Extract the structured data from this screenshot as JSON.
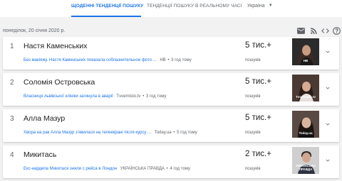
{
  "tabs": {
    "daily": "Щоденні тенденції пошуку",
    "realtime": "Тенденції пошуку в реальному часі"
  },
  "region": "Україна",
  "date": "понеділок, 20 січня 2020 р.",
  "icons": [
    "mail-icon",
    "rss-icon",
    "embed-code-icon",
    "help-icon",
    "chevron-down-icon"
  ],
  "accent_color": "#1a73e8",
  "trends": [
    {
      "rank": "1",
      "title": "Настя Каменських",
      "article": "Без макіяжу. Настя Каменських показала соблазнительное фото ...",
      "source": "НВ",
      "time": "3 год тому",
      "count": "5 тис.+",
      "count_label": "пошуків",
      "thumb_label": "НВ"
    },
    {
      "rank": "2",
      "title": "Соломія Островська",
      "article": "Власниця львівської клініки загинула в аварії",
      "source": "Tvoemisto.tv",
      "time": "3 год тому",
      "count": "5 тис.+",
      "count_label": "пошуків",
      "thumb_label": "Tvoemisto.tv"
    },
    {
      "rank": "3",
      "title": "Алла Мазур",
      "article": "Хвора на рак Алла Мазур з'явилася на телеекрані після курсу ...",
      "source": "Today.ua",
      "time": "5 год тому",
      "count": "5 тис.+",
      "count_label": "пошуків",
      "thumb_label": "Today.ua"
    },
    {
      "rank": "4",
      "title": "Микитась",
      "article": "Екс-нардепа Микитася зняли с рейса в Лондон",
      "source": "УКРАЇНСЬКА ПРАВДА",
      "time": "4 год тому",
      "count": "2 тис.+",
      "count_label": "пошуків",
      "thumb_label": "УКРАЇНСЬКА ПРАВДА"
    }
  ]
}
